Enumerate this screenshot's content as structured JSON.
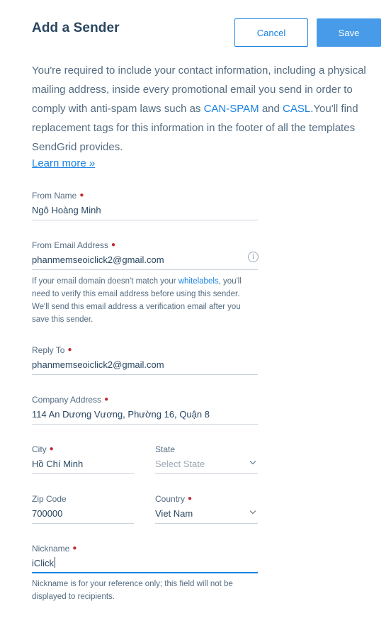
{
  "header": {
    "title": "Add a Sender",
    "cancel_label": "Cancel",
    "save_label": "Save"
  },
  "intro": {
    "text_before": "You're required to include your contact information, including a physical mailing address, inside every promotional email you send in order to comply with anti-spam laws such as ",
    "can_spam_link": "CAN-SPAM",
    "text_and": " and ",
    "casl_link": "CASL",
    "text_after": ".You'll find replacement tags for this information in the footer of all the templates SendGrid provides.",
    "learn_more": "Learn more »"
  },
  "form": {
    "from_name": {
      "label": "From Name",
      "value": "Ngô Hoàng Minh"
    },
    "from_email": {
      "label": "From Email Address",
      "value": "phanmemseoiclick2@gmail.com",
      "help_before": "If your email domain doesn't match your ",
      "help_link": "whitelabels",
      "help_after": ", you'll need to verify this email address before using this sender. We'll send this email address a verification email after you save this sender."
    },
    "reply_to": {
      "label": "Reply To",
      "value": "phanmemseoiclick2@gmail.com"
    },
    "company_address": {
      "label": "Company Address",
      "value": "114 An Dương Vương, Phường 16, Quận 8"
    },
    "city": {
      "label": "City",
      "value": "Hồ Chí Minh"
    },
    "state": {
      "label": "State",
      "placeholder": "Select State"
    },
    "zip": {
      "label": "Zip Code",
      "value": "700000"
    },
    "country": {
      "label": "Country",
      "value": "Viet Nam"
    },
    "nickname": {
      "label": "Nickname",
      "value": "iClick",
      "help": "Nickname is for your reference only; this field will not be displayed to recipients."
    }
  },
  "colors": {
    "primary": "#1a82e2",
    "save_button": "#489be8",
    "required_marker": "#c0272d",
    "text": "#294661"
  }
}
